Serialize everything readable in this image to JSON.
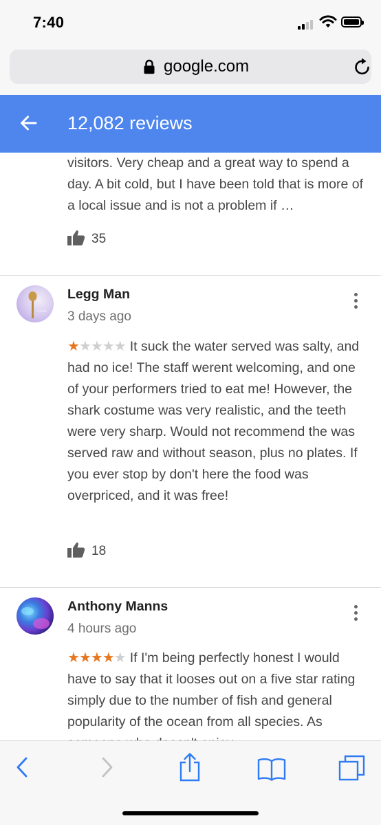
{
  "status_bar": {
    "time": "7:40"
  },
  "browser": {
    "url": "google.com"
  },
  "header": {
    "title": "12,082 reviews"
  },
  "reviews": [
    {
      "text": "visitors. Very cheap and a great way to spend a day. A bit cold, but I have been told that is more of a local issue and is not a problem if …",
      "likes": "35"
    },
    {
      "name": "Legg Man",
      "date": "3 days ago",
      "rating": 1,
      "text": "It suck the water served was salty, and had no ice! The staff werent welcoming, and one of your performers tried to eat me! However, the shark costume was very realistic, and the teeth were very sharp. Would not recommend the was served raw and without season, plus no plates. If you ever stop by don't here the food was overpriced, and it was free!",
      "likes": "18"
    },
    {
      "name": "Anthony Manns",
      "date": "4 hours ago",
      "rating": 4,
      "text": "If I'm being perfectly honest I would have to say that it looses out on a five star rating simply due to the number of fish and general popularity of the ocean from all species. As someone who doesn't enjoy"
    }
  ],
  "icons": {
    "lock": "lock-icon",
    "reload": "reload-icon",
    "back": "back-arrow-icon",
    "thumb": "thumbs-up-icon",
    "more": "more-vertical-icon",
    "star": "star-icon"
  },
  "colors": {
    "header": "#4e86ee",
    "star_on": "#e8761f",
    "star_off": "#cfcfcf",
    "toolbar_icon": "#2f7bf5"
  }
}
